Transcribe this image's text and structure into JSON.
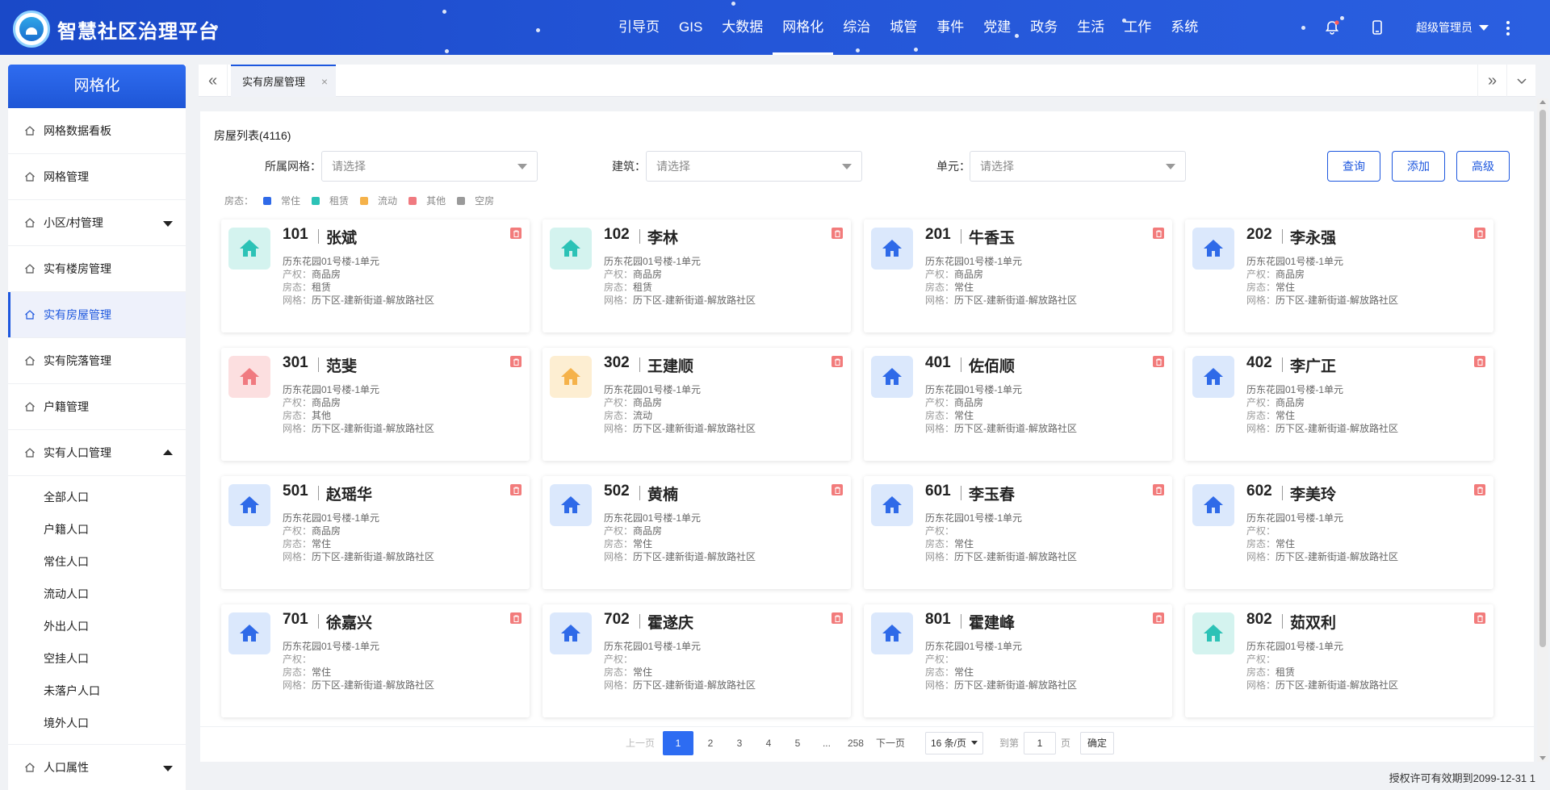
{
  "header": {
    "title": "智慧社区治理平台",
    "nav": [
      {
        "label": "引导页",
        "active": false
      },
      {
        "label": "GIS",
        "active": false
      },
      {
        "label": "大数据",
        "active": false
      },
      {
        "label": "网格化",
        "active": true
      },
      {
        "label": "综治",
        "active": false
      },
      {
        "label": "城管",
        "active": false
      },
      {
        "label": "事件",
        "active": false
      },
      {
        "label": "党建",
        "active": false
      },
      {
        "label": "政务",
        "active": false
      },
      {
        "label": "生活",
        "active": false
      },
      {
        "label": "工作",
        "active": false
      },
      {
        "label": "系统",
        "active": false
      }
    ],
    "user": "超级管理员"
  },
  "sidebar": {
    "title": "网格化",
    "items": [
      {
        "label": "网格数据看板"
      },
      {
        "label": "网格管理"
      },
      {
        "label": "小区/村管理"
      },
      {
        "label": "实有楼房管理"
      },
      {
        "label": "实有房屋管理"
      },
      {
        "label": "实有院落管理"
      },
      {
        "label": "户籍管理"
      },
      {
        "label": "实有人口管理"
      },
      {
        "label": "人口属性"
      }
    ],
    "sub_items": [
      "全部人口",
      "户籍人口",
      "常住人口",
      "流动人口",
      "外出人口",
      "空挂人口",
      "未落户人口",
      "境外人口"
    ]
  },
  "tabs": {
    "active": "实有房屋管理",
    "close": "×",
    "prev": "«",
    "next": "»",
    "menu": "⌄"
  },
  "main": {
    "list_title": "房屋列表(4116)",
    "filters": {
      "grid_label": "所属网格：",
      "grid_placeholder": "请选择",
      "building_label": "建筑：",
      "building_placeholder": "请选择",
      "unit_label": "单元：",
      "unit_placeholder": "请选择"
    },
    "buttons": {
      "query": "查询",
      "add": "添加",
      "advanced": "高级"
    },
    "legend": {
      "label": "房态：",
      "items": [
        {
          "label": "常住",
          "color": "#2f6ae8"
        },
        {
          "label": "租赁",
          "color": "#2cc2b6"
        },
        {
          "label": "流动",
          "color": "#f5b24a"
        },
        {
          "label": "其他",
          "color": "#f07a80"
        },
        {
          "label": "空房",
          "color": "#9a9a9a"
        }
      ]
    },
    "field_labels": {
      "property": "产权：",
      "status": "房态：",
      "grid": "网格："
    },
    "cards": [
      {
        "room": "101",
        "owner": "张斌",
        "address": "历东花园01号楼-1单元",
        "property": "商品房",
        "status": "租赁",
        "grid": "历下区-建新街道-解放路社区",
        "color": "teal"
      },
      {
        "room": "102",
        "owner": "李林",
        "address": "历东花园01号楼-1单元",
        "property": "商品房",
        "status": "租赁",
        "grid": "历下区-建新街道-解放路社区",
        "color": "teal"
      },
      {
        "room": "201",
        "owner": "牛香玉",
        "address": "历东花园01号楼-1单元",
        "property": "商品房",
        "status": "常住",
        "grid": "历下区-建新街道-解放路社区",
        "color": "blue"
      },
      {
        "room": "202",
        "owner": "李永强",
        "address": "历东花园01号楼-1单元",
        "property": "商品房",
        "status": "常住",
        "grid": "历下区-建新街道-解放路社区",
        "color": "blue"
      },
      {
        "room": "301",
        "owner": "范斐",
        "address": "历东花园01号楼-1单元",
        "property": "商品房",
        "status": "其他",
        "grid": "历下区-建新街道-解放路社区",
        "color": "red"
      },
      {
        "room": "302",
        "owner": "王建顺",
        "address": "历东花园01号楼-1单元",
        "property": "商品房",
        "status": "流动",
        "grid": "历下区-建新街道-解放路社区",
        "color": "orange"
      },
      {
        "room": "401",
        "owner": "佐佰顺",
        "address": "历东花园01号楼-1单元",
        "property": "商品房",
        "status": "常住",
        "grid": "历下区-建新街道-解放路社区",
        "color": "blue"
      },
      {
        "room": "402",
        "owner": "李广正",
        "address": "历东花园01号楼-1单元",
        "property": "商品房",
        "status": "常住",
        "grid": "历下区-建新街道-解放路社区",
        "color": "blue"
      },
      {
        "room": "501",
        "owner": "赵瑶华",
        "address": "历东花园01号楼-1单元",
        "property": "商品房",
        "status": "常住",
        "grid": "历下区-建新街道-解放路社区",
        "color": "blue"
      },
      {
        "room": "502",
        "owner": "黄楠",
        "address": "历东花园01号楼-1单元",
        "property": "商品房",
        "status": "常住",
        "grid": "历下区-建新街道-解放路社区",
        "color": "blue"
      },
      {
        "room": "601",
        "owner": "李玉春",
        "address": "历东花园01号楼-1单元",
        "property": "",
        "status": "常住",
        "grid": "历下区-建新街道-解放路社区",
        "color": "blue"
      },
      {
        "room": "602",
        "owner": "李美玲",
        "address": "历东花园01号楼-1单元",
        "property": "",
        "status": "常住",
        "grid": "历下区-建新街道-解放路社区",
        "color": "blue"
      },
      {
        "room": "701",
        "owner": "徐嘉兴",
        "address": "历东花园01号楼-1单元",
        "property": "",
        "status": "常住",
        "grid": "历下区-建新街道-解放路社区",
        "color": "blue"
      },
      {
        "room": "702",
        "owner": "霍遂庆",
        "address": "历东花园01号楼-1单元",
        "property": "",
        "status": "常住",
        "grid": "历下区-建新街道-解放路社区",
        "color": "blue"
      },
      {
        "room": "801",
        "owner": "霍建峰",
        "address": "历东花园01号楼-1单元",
        "property": "",
        "status": "常住",
        "grid": "历下区-建新街道-解放路社区",
        "color": "blue"
      },
      {
        "room": "802",
        "owner": "茹双利",
        "address": "历东花园01号楼-1单元",
        "property": "",
        "status": "租赁",
        "grid": "历下区-建新街道-解放路社区",
        "color": "teal"
      }
    ],
    "pagination": {
      "prev": "上一页",
      "pages": [
        "1",
        "2",
        "3",
        "4",
        "5",
        "...",
        "258"
      ],
      "current": "1",
      "next": "下一页",
      "page_size": "16 条/页",
      "goto_label": "到第",
      "goto_value": "1",
      "page_label": "页",
      "confirm": "确定"
    }
  },
  "footer": {
    "license": "授权许可有效期到2099-12-31 1"
  },
  "colors": {
    "primary": "#1d57de",
    "header": "#2456d8",
    "teal_bg": "#d4f3ef",
    "teal_fg": "#2cc2b6",
    "blue_bg": "#dbe8fc",
    "blue_fg": "#2f6ae8",
    "red_bg": "#fcdfe0",
    "red_fg": "#f07a80",
    "orange_bg": "#fdeed2",
    "orange_fg": "#f5b24a"
  }
}
